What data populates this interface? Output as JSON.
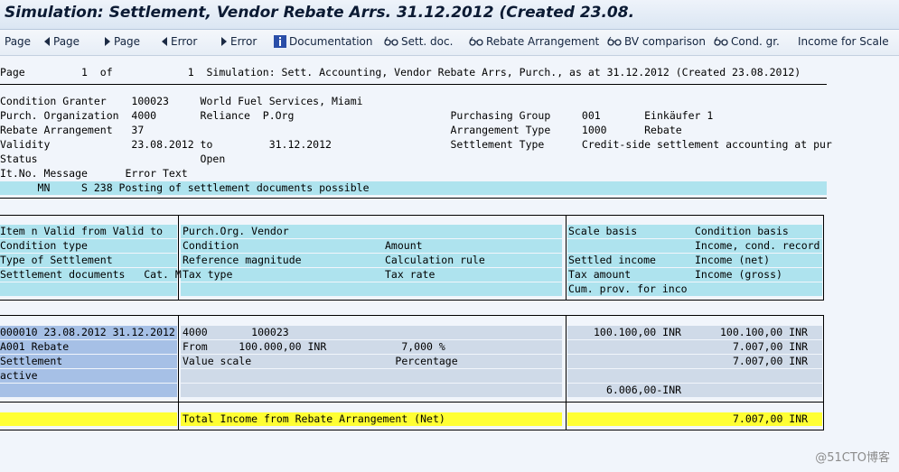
{
  "window": {
    "title": "Simulation: Settlement, Vendor Rebate Arrs. 31.12.2012 (Created 23.08."
  },
  "toolbar": {
    "first_page": "Page",
    "previous_page": "Page",
    "next_page": "Page",
    "previous_error": "Error",
    "next_error": "Error",
    "documentation": "Documentation",
    "sett_doc": "Sett. doc.",
    "rebate_arrangement": "Rebate Arrangement",
    "bv_comparison": "BV comparison",
    "cond_gr": "Cond. gr.",
    "income_for_scale": "Income for Scale"
  },
  "report": {
    "page_header": "Page         1  of            1  Simulation: Sett. Accounting, Vendor Rebate Arrs, Purch., as at 31.12.2012 (Created 23.08.2012)",
    "header_lines": [
      "Condition Granter    100023     World Fuel Services, Miami",
      "Purch. Organization  4000       Reliance  P.Org                         Purchasing Group     001       Einkäufer 1",
      "Rebate Arrangement   37                                                 Arrangement Type     1000      Rebate",
      "Validity             23.08.2012 to         31.12.2012                   Settlement Type      Credit-side settlement accounting at pur",
      "Status                          Open",
      "It.No. Message      Error Text"
    ],
    "message_line": "      MN     S 238 Posting of settlement documents possible",
    "col_headers": {
      "left": [
        "Item n Valid from Valid to",
        "Condition type",
        "Type of Settlement",
        "Settlement documents   Cat. M"
      ],
      "mid_a": [
        "Purch.Org. Vendor",
        "Condition",
        "Reference magnitude",
        "Tax type"
      ],
      "mid_b": [
        "",
        "Amount",
        "Calculation rule",
        "Tax rate"
      ],
      "right_a": [
        "Scale basis",
        "",
        "Settled income",
        "Tax amount",
        "Cum. prov. for inco"
      ],
      "right_b": [
        "Condition basis",
        "Income, cond. record",
        "Income (net)",
        "Income (gross)",
        ""
      ]
    },
    "item": {
      "left": [
        "000010 23.08.2012 31.12.2012",
        "A001 Rebate",
        "Settlement",
        "active"
      ],
      "mid": [
        "4000       100023",
        "From     100.000,00 INR            7,000 %",
        "Value scale                       Percentage"
      ],
      "right_a": [
        "100.100,00 INR",
        "",
        "",
        "",
        "6.006,00-INR"
      ],
      "right_b": [
        "100.100,00 INR",
        "7.007,00 INR",
        "7.007,00 INR",
        "",
        ""
      ]
    },
    "total": {
      "label": "Total Income from Rebate Arrangement (Net)",
      "amount": "7.007,00 INR"
    }
  },
  "watermark": "@51CTO博客",
  "colors": {
    "header_bg": "#aee3ee",
    "item_key_bg": "#a6c0e6",
    "item_row_bg": "#cfdae8",
    "total_bg": "#ffff33"
  }
}
